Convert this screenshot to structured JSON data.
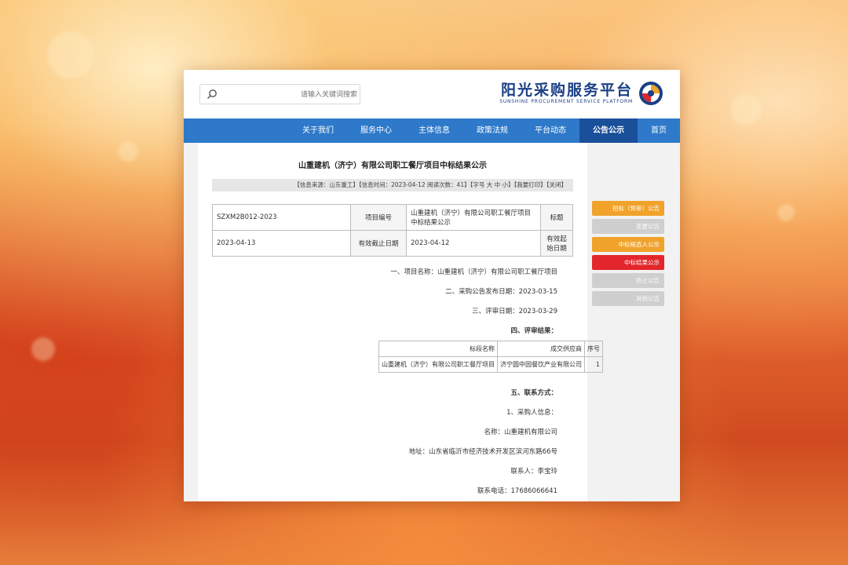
{
  "header": {
    "search_placeholder": "请输入关键词搜索",
    "logo_title": "阳光采购服务平台",
    "logo_subtitle": "SUNSHINE PROCUREMENT SERVICE PLATFORM"
  },
  "nav": [
    "首页",
    "公告公示",
    "平台动态",
    "政策法规",
    "主体信息",
    "服务中心",
    "关于我们"
  ],
  "nav_active": "公告公示",
  "document": {
    "title": "山重建机（济宁）有限公司职工餐厅项目中标结果公示",
    "meta": "【信息来源：山东重工】【信息时间：2023-04-12  阅读次数：41】【字号 大 中 小】【我要打印】【关闭】",
    "info_table": {
      "row1": {
        "label1": "标题",
        "value1": "山重建机（济宁）有限公司职工餐厅项目中标结果公示",
        "label2": "项目编号",
        "value2": "SZXM2B012-2023"
      },
      "row2": {
        "label1": "有效起始日期",
        "value1": "2023-04-12",
        "label2": "有效截止日期",
        "value2": "2023-04-13"
      }
    },
    "lines": {
      "project_name": "一、项目名称：山重建机（济宁）有限公司职工餐厅项目",
      "publish_date": "二、采购公告发布日期：2023-03-15",
      "review_date": "三、评审日期：2023-03-29",
      "result_heading": "四、评审结果：",
      "contact_heading": "五、联系方式：",
      "purchaser": "1、采购人信息：",
      "name": "名称：山重建机有限公司",
      "address": "地址：山东省临沂市经济技术开发区滨河东路66号",
      "contact_person": "联系人：李宝玲",
      "contact_phone": "联系电话：17686066641"
    },
    "result_table": {
      "headers": {
        "no": "序号",
        "supplier": "成交供应商",
        "bid": "标段名称"
      },
      "row": {
        "no": "1",
        "supplier": "济宁圆中园餐饮产业有限公司",
        "bid": "山重建机（济宁）有限公司职工餐厅项目"
      }
    }
  },
  "sidebar": [
    {
      "label": "招标（预审）公告",
      "color": "orange"
    },
    {
      "label": "变更公告",
      "color": "gray"
    },
    {
      "label": "中标候选人公示",
      "color": "orange"
    },
    {
      "label": "中标结果公示",
      "color": "red"
    },
    {
      "label": "终止公告",
      "color": "gray"
    },
    {
      "label": "其他公告",
      "color": "gray"
    }
  ],
  "colors": {
    "nav": "#2e79c9",
    "nav_active": "#1a4f9a",
    "orange": "#f0a22a",
    "red": "#e2262b",
    "logo": "#1a3f86"
  }
}
